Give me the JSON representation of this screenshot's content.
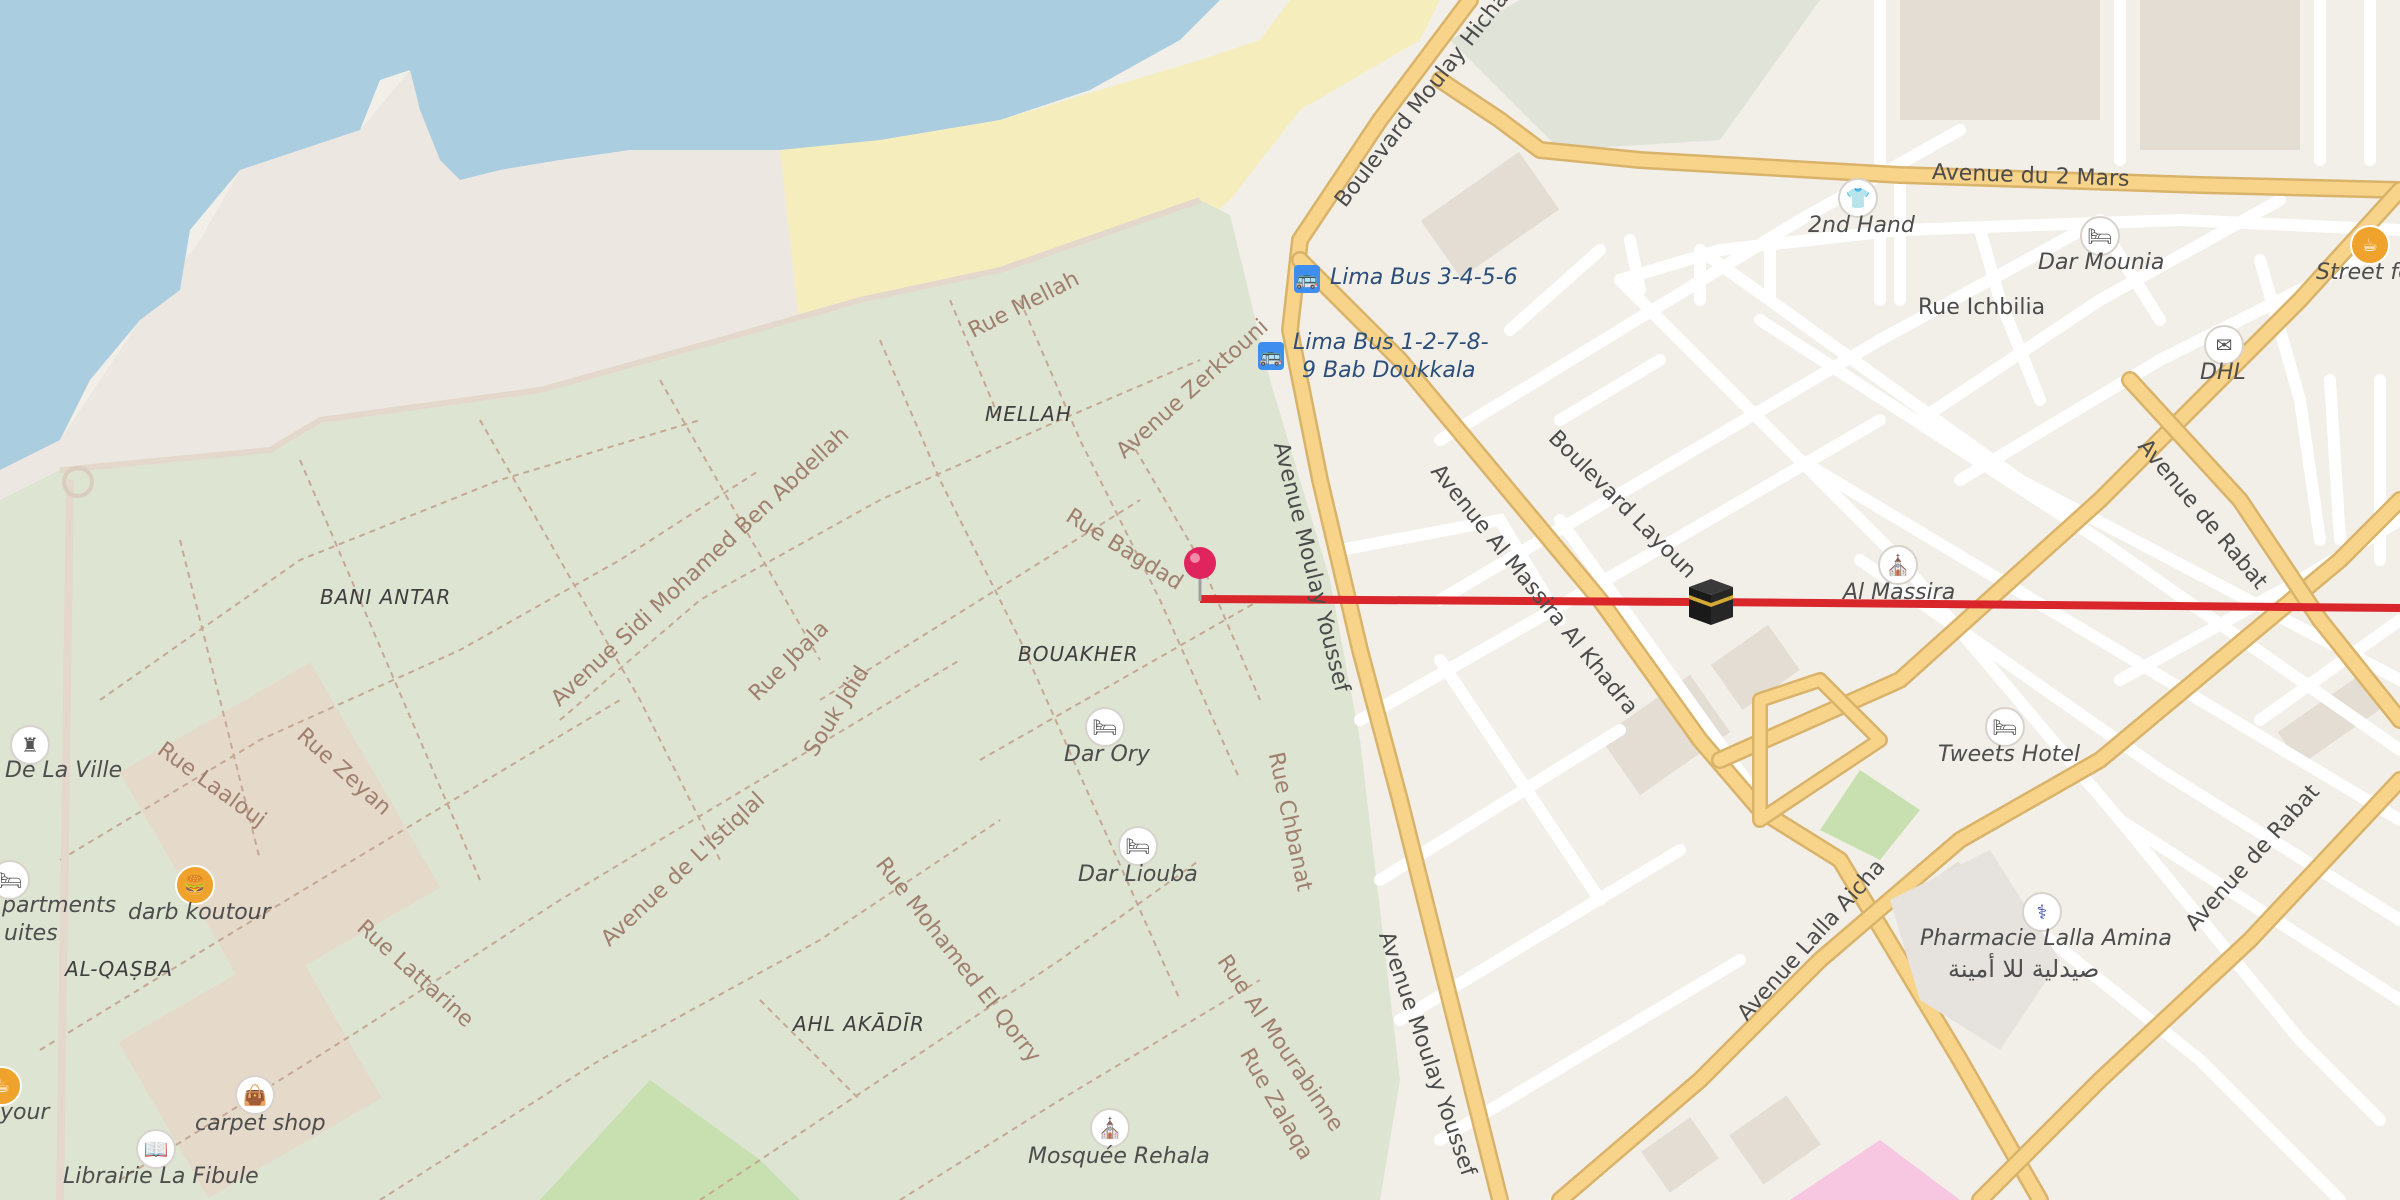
{
  "map": {
    "districts": [
      "MELLAH",
      "BANI ANTAR",
      "BOUAKHER",
      "AL-QAṢBA",
      "AHL AKĀDĪR"
    ],
    "streets": {
      "rue_mellah": "Rue Mellah",
      "av_zerktouni": "Avenue Zerktouni",
      "av_sidi_mohamed": "Avenue Sidi Mohamed Ben Abdellah",
      "rue_bagdad": "Rue Bagdad",
      "rue_jbala": "Rue Jbala",
      "souk_jdid": "Souk Jdid",
      "av_istiqlal": "Avenue de L'Istiqlal",
      "rue_laalouj": "Rue Laalouj",
      "rue_zeyan": "Rue Zeyan",
      "rue_lattarine": "Rue Lattarine",
      "rue_mohamed_el_qorry": "Rue Mohamed El Qorry",
      "rue_chbanat": "Rue Chbanat",
      "rue_al_mourabinne": "Rue Al Mourabinne",
      "rue_zalaqa": "Rue Zalaqa",
      "av_moulay_youssef_1": "Avenue Moulay Youssef",
      "av_moulay_youssef_2": "Avenue Moulay Youssef",
      "bd_moulay_hicham": "Boulevard Moulay Hicham",
      "av_2_mars": "Avenue du 2 Mars",
      "rue_ichbilia": "Rue Ichbilia",
      "bd_layoun": "Boulevard Layoun",
      "av_al_massira": "Avenue Al Massira Al Khadra",
      "av_rabat_1": "Avenue de Rabat",
      "av_rabat_2": "Avenue de Rabat",
      "av_lalla_aicha": "Avenue Lalla Aicha"
    },
    "pois": {
      "dar_ory": "Dar Ory",
      "dar_liouba": "Dar Liouba",
      "mosquee_rehala": "Mosquée Rehala",
      "darb_koutour": "darb koutour",
      "carpet_shop": "carpet shop",
      "librairie": "Librairie La Fibule",
      "de_la_ville": "De La Ville",
      "apartments": "partments",
      "suites": "uites",
      "your": "your",
      "second_hand": "2nd Hand",
      "dar_mounia": "Dar Mounia",
      "street_fo": "Street fo",
      "dhl": "DHL",
      "al_massira": "Al Massira",
      "tweets_hotel": "Tweets Hotel",
      "pharmacie": "Pharmacie Lalla Amina",
      "pharmacie_ar": "صيدلية للا أمينة"
    },
    "bus_stops": {
      "stop1": "Lima Bus 3-4-5-6",
      "stop2_line1": "Lima Bus 1-2-7-8-",
      "stop2_line2": "9 Bab Doukkala"
    },
    "icons": [
      "castle-icon",
      "burger-icon",
      "shopping-bag-icon",
      "book-icon",
      "bed-icon",
      "shirt-icon",
      "cup-icon",
      "mail-icon",
      "mosque-icon",
      "pharmacy-icon",
      "bus-icon",
      "location-pin-icon",
      "kaaba-icon"
    ],
    "colors": {
      "water": "#abcde0",
      "medina": "#dde4d2",
      "sand": "#f5eebc",
      "land": "#f2efe9",
      "major_road": "#f5cf7c",
      "route_line": "#d9262b",
      "pin": "#e0245e"
    }
  }
}
